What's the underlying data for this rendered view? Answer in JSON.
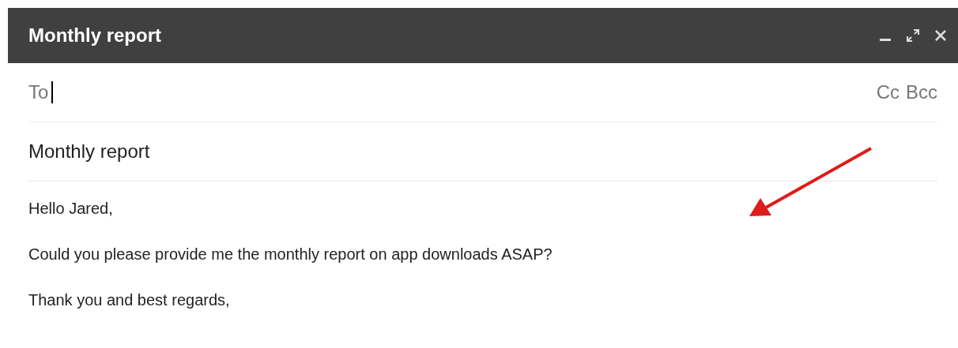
{
  "window": {
    "title": "Monthly report"
  },
  "to": {
    "label": "To"
  },
  "cc": "Cc",
  "bcc": "Bcc",
  "subject": "Monthly report",
  "body": [
    "Hello Jared,",
    "Could you please provide me the monthly report on app downloads ASAP?",
    "Thank you and best regards,"
  ]
}
